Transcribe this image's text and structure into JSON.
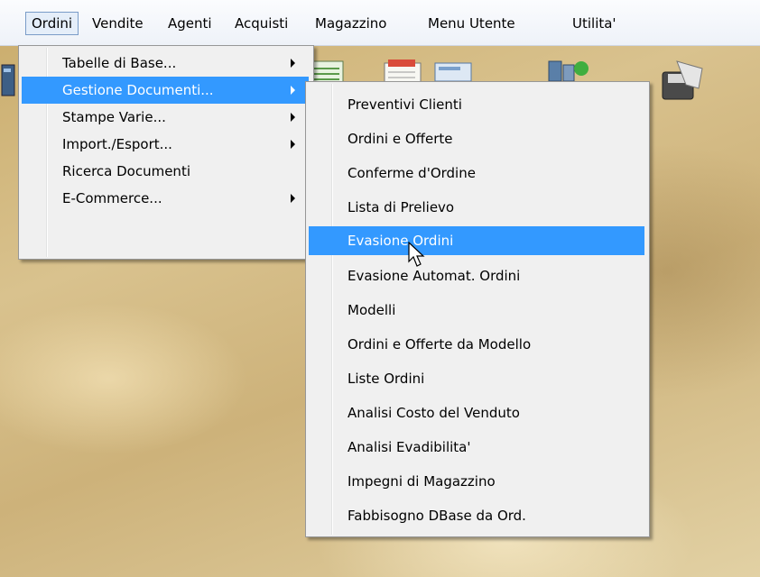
{
  "menubar": {
    "items": [
      "Ordini",
      "Vendite",
      "Agenti",
      "Acquisti",
      "Magazzino",
      "Menu Utente",
      "Utilita'"
    ]
  },
  "main_menu": {
    "items": [
      {
        "label": "Tabelle di Base...",
        "has_submenu": true
      },
      {
        "label": "Gestione Documenti...",
        "has_submenu": true,
        "highlighted": true
      },
      {
        "label": "Stampe Varie...",
        "has_submenu": true
      },
      {
        "label": "Import./Esport...",
        "has_submenu": true
      },
      {
        "label": "Ricerca Documenti",
        "has_submenu": false
      },
      {
        "label": "E-Commerce...",
        "has_submenu": true
      }
    ]
  },
  "sub_menu": {
    "items": [
      {
        "label": "Preventivi Clienti"
      },
      {
        "label": "Ordini e Offerte"
      },
      {
        "label": "Conferme d'Ordine"
      },
      {
        "label": "Lista di Prelievo"
      },
      {
        "label": "Evasione Ordini",
        "highlighted": true
      },
      {
        "label": "Evasione Automat. Ordini"
      },
      {
        "label": "Modelli"
      },
      {
        "label": "Ordini e Offerte da Modello"
      },
      {
        "label": "Liste Ordini"
      },
      {
        "label": "Analisi Costo del Venduto"
      },
      {
        "label": "Analisi Evadibilita'"
      },
      {
        "label": "Impegni di Magazzino"
      },
      {
        "label": "Fabbisogno DBase da Ord."
      }
    ]
  },
  "toolbar": {
    "icons": [
      "tool-icon",
      "spreadsheet-icon",
      "document-edit-icon",
      "report-icon",
      "database-refresh-icon",
      "save-disk-icon"
    ]
  },
  "colors": {
    "highlight": "#3399ff",
    "menu_bg": "#f0f0f0",
    "menubar_bg": "#f5f7fb"
  }
}
